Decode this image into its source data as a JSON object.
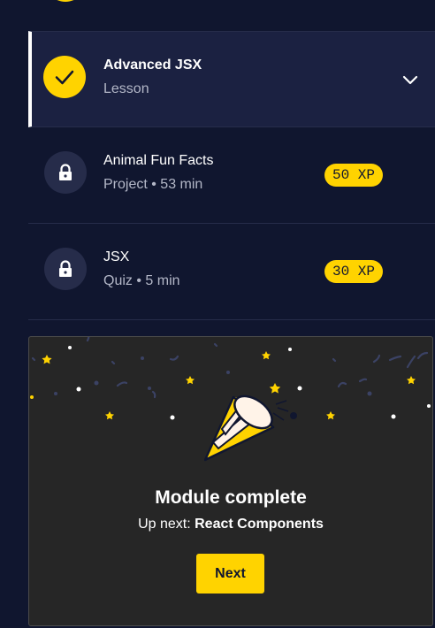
{
  "colors": {
    "background": "#10162f",
    "active_row": "#1b2141",
    "accent_yellow": "#ffd300",
    "card_background": "#262626",
    "muted_text": "#b3b7c7"
  },
  "items": [
    {
      "title": "Advanced JSX",
      "subtitle": "Lesson",
      "status_icon": "checkmark-icon",
      "state": "completed-expanded",
      "toggle_icon": "chevron-down-icon"
    },
    {
      "title": "Animal Fun Facts",
      "subtitle": "Project • 53 min",
      "status_icon": "lock-icon",
      "state": "locked",
      "xp": "50 XP"
    },
    {
      "title": "JSX",
      "subtitle": "Quiz • 5 min",
      "status_icon": "lock-icon",
      "state": "locked",
      "xp": "30 XP"
    }
  ],
  "module_card": {
    "illustration": "party-popper-icon",
    "title": "Module complete",
    "upnext_prefix": "Up next:",
    "upnext_name": "React Components",
    "next_button_label": "Next"
  }
}
